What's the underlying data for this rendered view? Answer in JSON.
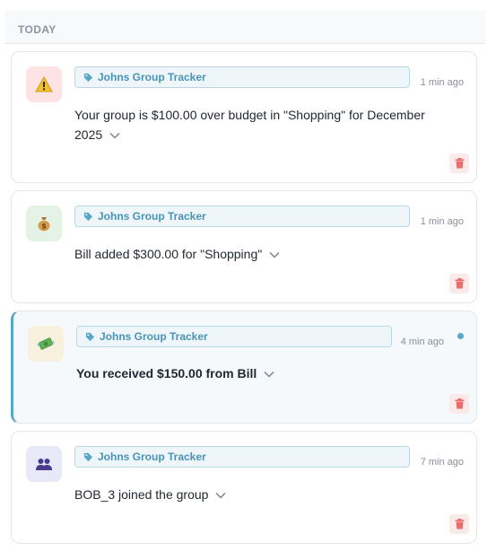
{
  "section": {
    "title": "TODAY"
  },
  "notifications": [
    {
      "icon": "warning-icon",
      "icon_bg": "#fde3e3",
      "group": "Johns Group Tracker",
      "time": "1 min ago",
      "message_line1": "Your group is $100.00 over budget in \"Shopping\" for December",
      "message_line2": "2025",
      "unread": false
    },
    {
      "icon": "money-bag-icon",
      "icon_bg": "#e4f3e6",
      "group": "Johns Group Tracker",
      "time": "1 min ago",
      "message": "Bill added $300.00 for \"Shopping\"",
      "unread": false
    },
    {
      "icon": "money-wings-icon",
      "icon_bg": "#f7f1de",
      "group": "Johns Group Tracker",
      "time": "4 min ago",
      "message": "You received $150.00 from Bill",
      "unread": true
    },
    {
      "icon": "group-icon",
      "icon_bg": "#e7e8f8",
      "group": "Johns Group Tracker",
      "time": "7 min ago",
      "message": "BOB_3 joined the group",
      "unread": false
    }
  ],
  "colors": {
    "accent": "#5aa6c8",
    "tag_text": "#4a93b6",
    "delete": "#ef6b6b"
  }
}
